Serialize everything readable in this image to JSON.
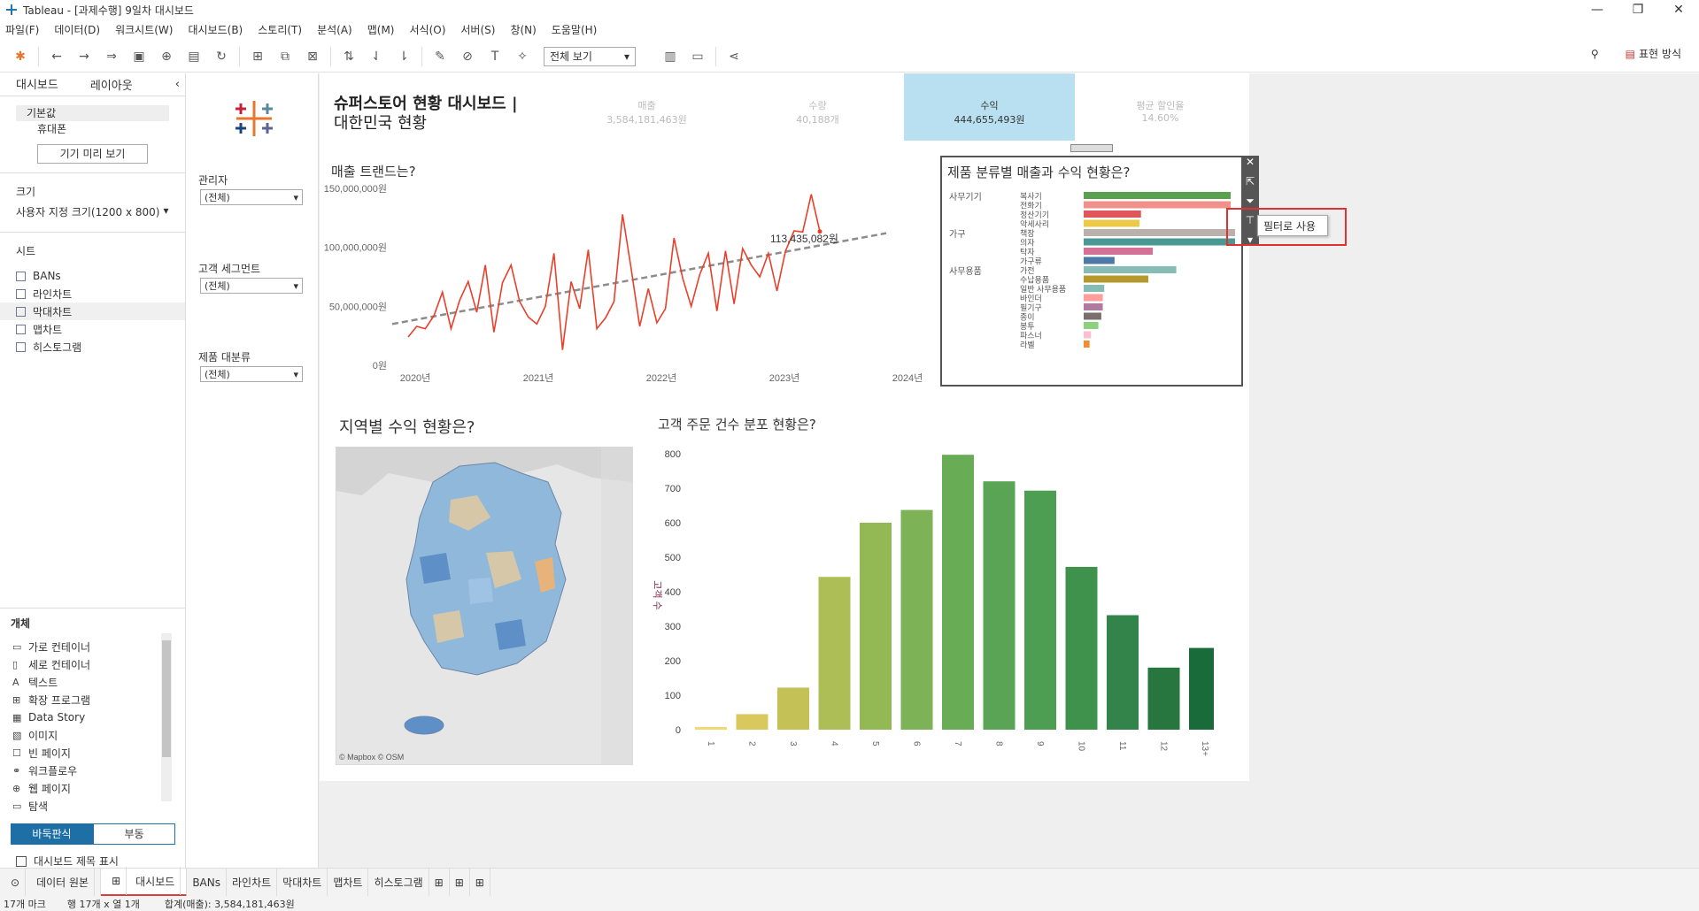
{
  "window": {
    "title": "Tableau - [과제수행] 9일차 대시보드"
  },
  "menu": [
    "파일(F)",
    "데이터(D)",
    "워크시트(W)",
    "대시보드(B)",
    "스토리(T)",
    "분석(A)",
    "맵(M)",
    "서식(O)",
    "서버(S)",
    "창(N)",
    "도움말(H)"
  ],
  "toolbar": {
    "view_select": "전체 보기",
    "showme": "표현 방식"
  },
  "left_pane": {
    "tabs": [
      "대시보드",
      "레이아웃"
    ],
    "devices": [
      "기본값",
      "휴대폰"
    ],
    "preview_button": "기기 미리 보기",
    "size_label": "크기",
    "size_value": "사용자 지정 크기(1200 x 800)",
    "sheets_label": "시트",
    "sheets": [
      "BANs",
      "라인차트",
      "막대차트",
      "맵차트",
      "히스토그램"
    ],
    "objects_label": "개체",
    "objects": [
      "가로 컨테이너",
      "세로 컨테이너",
      "텍스트",
      "확장 프로그램",
      "Data Story",
      "이미지",
      "빈 페이지",
      "워크플로우",
      "웹 페이지",
      "탐색"
    ],
    "tiled": "바둑판식",
    "floating": "부동",
    "show_title": "대시보드 제목 표시"
  },
  "filters": [
    {
      "label": "관리자",
      "value": "(전체)"
    },
    {
      "label": "고객 세그먼트",
      "value": "(전체)"
    },
    {
      "label": "제품 대분류",
      "value": "(전체)"
    }
  ],
  "dashboard": {
    "title1": "슈퍼스토어 현황 대시보드 |",
    "title2": "대한민국 현황",
    "bans": [
      {
        "label": "매출",
        "value": "3,584,181,463원"
      },
      {
        "label": "수량",
        "value": "40,188개"
      },
      {
        "label": "수익",
        "value": "444,655,493원"
      },
      {
        "label": "평균 할인율",
        "value": "14.60%"
      }
    ],
    "trend_title": "매출 트랜드는?",
    "map_title": "지역별 수익 현황은?",
    "map_credit": "© Mapbox © OSM",
    "hist_title": "고객 주문 건수 분포 현황은?",
    "tooltip_title": "제품 분류별 매출과 수익 현황은?",
    "filter_action": "필터로 사용",
    "last_value_label": "113,435,082원"
  },
  "colors": {
    "accent": "#b9e0f0",
    "line": "#e8402a",
    "trend": "#8c8c8c",
    "hist_dark": "#1a6b3a",
    "hist_light": "#f0d66a"
  },
  "chart_data": [
    {
      "type": "line",
      "title": "매출 트랜드는?",
      "x_ticks": [
        "2020년",
        "2021년",
        "2022년",
        "2023년",
        "2024년"
      ],
      "y_ticks": [
        "150,000,000원",
        "100,000,000원",
        "50,000,000원",
        "0원"
      ],
      "ylim": [
        0,
        150000000
      ],
      "values": [
        24000000,
        33000000,
        31000000,
        42000000,
        62000000,
        31000000,
        55000000,
        71000000,
        45000000,
        85000000,
        28000000,
        70000000,
        85000000,
        54000000,
        41000000,
        35000000,
        50000000,
        95000000,
        13000000,
        71000000,
        48000000,
        98000000,
        31000000,
        40000000,
        54000000,
        128000000,
        82000000,
        33000000,
        65000000,
        36000000,
        48000000,
        108000000,
        74000000,
        50000000,
        77000000,
        95000000,
        46000000,
        97000000,
        52000000,
        99000000,
        85000000,
        75000000,
        95000000,
        63000000,
        97000000,
        114000000,
        113000000,
        145000000,
        113435082
      ],
      "trend": [
        35000000,
        112000000
      ]
    },
    {
      "type": "bar",
      "title": "고객 주문 건수 분포 현황은?",
      "ylabel": "고객 수",
      "categories": [
        "1",
        "2",
        "3",
        "4",
        "5",
        "6",
        "7",
        "8",
        "9",
        "10",
        "11",
        "12",
        "13+"
      ],
      "values": [
        8,
        45,
        122,
        443,
        600,
        637,
        797,
        720,
        693,
        472,
        332,
        180,
        237
      ],
      "y_ticks": [
        800,
        700,
        600,
        500,
        400,
        300,
        200,
        100,
        0
      ],
      "ylim": [
        0,
        800
      ]
    },
    {
      "type": "bar",
      "title": "제품 분류별 매출과 수익 현황은?",
      "groups": [
        {
          "name": "사무기기",
          "items": [
            {
              "label": "복사기",
              "value": 100,
              "color": "#59a14f"
            },
            {
              "label": "전화기",
              "value": 100,
              "color": "#f1918c"
            },
            {
              "label": "정산기기",
              "value": 39,
              "color": "#e15759"
            },
            {
              "label": "악세사리",
              "value": 38,
              "color": "#edc948"
            }
          ]
        },
        {
          "name": "가구",
          "items": [
            {
              "label": "책장",
              "value": 103,
              "color": "#bab0ac"
            },
            {
              "label": "의자",
              "value": 103,
              "color": "#499894"
            },
            {
              "label": "탁자",
              "value": 47,
              "color": "#d37295"
            },
            {
              "label": "가구류",
              "value": 21,
              "color": "#4e79a7"
            }
          ]
        },
        {
          "name": "사무용품",
          "items": [
            {
              "label": "가전",
              "value": 63,
              "color": "#86bcb6"
            },
            {
              "label": "수납용품",
              "value": 44,
              "color": "#b6992d"
            },
            {
              "label": "일반 사무용품",
              "value": 14,
              "color": "#86bcb6"
            },
            {
              "label": "바인더",
              "value": 13,
              "color": "#ff9d9a"
            },
            {
              "label": "필기구",
              "value": 13,
              "color": "#b07aa1"
            },
            {
              "label": "종이",
              "value": 12,
              "color": "#79706e"
            },
            {
              "label": "봉투",
              "value": 10,
              "color": "#8cd17d"
            },
            {
              "label": "파스너",
              "value": 5,
              "color": "#fabfd2"
            },
            {
              "label": "라벨",
              "value": 4,
              "color": "#f28e2b"
            }
          ]
        }
      ]
    }
  ],
  "sheet_tabs": [
    "데이터 원본",
    "대시보드",
    "BANs",
    "라인차트",
    "막대차트",
    "맵차트",
    "히스토그램"
  ],
  "status": {
    "marks": "17개 마크",
    "rows_cols": "행 17개  x  열 1개",
    "sum": "합계(매출): 3,584,181,463원"
  }
}
